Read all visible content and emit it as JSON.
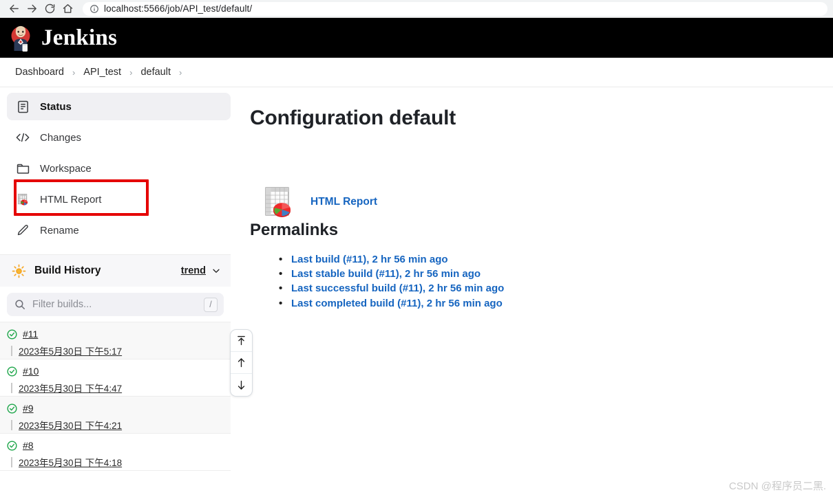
{
  "browser": {
    "back_label": "Back",
    "forward_label": "Forward",
    "reload_label": "Reload",
    "home_label": "Home",
    "site_info_label": "Site information",
    "url": "localhost:5566/job/API_test/default/"
  },
  "header": {
    "brand": "Jenkins"
  },
  "breadcrumb": {
    "items": [
      {
        "label": "Dashboard"
      },
      {
        "label": "API_test"
      },
      {
        "label": "default"
      }
    ],
    "separator": "›"
  },
  "sidebar": {
    "items": [
      {
        "label": "Status",
        "icon": "document-icon",
        "active": true
      },
      {
        "label": "Changes",
        "icon": "code-icon",
        "active": false
      },
      {
        "label": "Workspace",
        "icon": "folder-icon",
        "active": false
      },
      {
        "label": "HTML Report",
        "icon": "html-report-icon",
        "active": false
      },
      {
        "label": "Rename",
        "icon": "pencil-icon",
        "active": false
      }
    ],
    "build_history": {
      "title": "Build History",
      "icon": "sun-icon",
      "trend_label": "trend",
      "filter_placeholder": "Filter builds...",
      "filter_value": "",
      "filter_shortcut": "/",
      "builds": [
        {
          "number": "#11",
          "date": "2023年5月30日 下午5:17",
          "status": "success"
        },
        {
          "number": "#10",
          "date": "2023年5月30日 下午4:47",
          "status": "success"
        },
        {
          "number": "#9",
          "date": "2023年5月30日 下午4:21",
          "status": "success"
        },
        {
          "number": "#8",
          "date": "2023年5月30日 下午4:18",
          "status": "success"
        }
      ]
    },
    "scroll_controls": [
      {
        "name": "scroll-to-top-button",
        "icon": "arrow-to-top-icon"
      },
      {
        "name": "scroll-up-button",
        "icon": "arrow-up-icon"
      },
      {
        "name": "scroll-down-button",
        "icon": "arrow-down-icon"
      }
    ],
    "annotation": {
      "target": "HTML Report",
      "color": "#e50000"
    }
  },
  "main": {
    "title": "Configuration default",
    "report": {
      "link_label": "HTML Report",
      "icon": "html-report-icon"
    },
    "permalinks_heading": "Permalinks",
    "permalinks": [
      {
        "label": "Last build (#11), 2 hr 56 min ago"
      },
      {
        "label": "Last stable build (#11), 2 hr 56 min ago"
      },
      {
        "label": "Last successful build (#11), 2 hr 56 min ago"
      },
      {
        "label": "Last completed build (#11), 2 hr 56 min ago"
      }
    ]
  },
  "watermark": "CSDN @程序员二黑.",
  "colors": {
    "link": "#1665c0",
    "success": "#1ea64a",
    "annotation": "#e50000",
    "header_bg": "#000000"
  }
}
